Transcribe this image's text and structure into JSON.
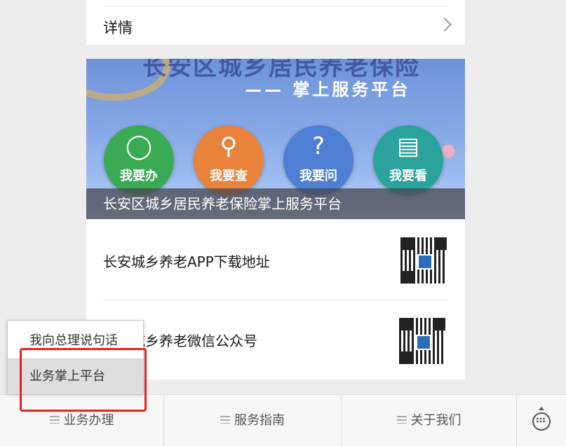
{
  "top_card": {
    "label": "详情"
  },
  "banner": {
    "headline": "长安区城乡居民养老保险",
    "subtitle": "—— 掌上服务平台",
    "buttons": [
      {
        "label": "我要办",
        "icon": "person-icon",
        "color": "#3aaa55"
      },
      {
        "label": "我要查",
        "icon": "search-icon",
        "color": "#e9823a"
      },
      {
        "label": "我要问",
        "icon": "question-icon",
        "color": "#4f7fd2"
      },
      {
        "label": "我要看",
        "icon": "document-icon",
        "color": "#2aa39c"
      }
    ],
    "caption": "长安区城乡居民养老保险掌上服务平台"
  },
  "qr_list": [
    {
      "label": "长安城乡养老APP下载地址"
    },
    {
      "label": "长安城乡养老微信公众号"
    }
  ],
  "popup": {
    "items": [
      "我向总理说句话",
      "业务掌上平台"
    ]
  },
  "tabbar": {
    "tabs": [
      "业务办理",
      "服务指南",
      "关于我们"
    ]
  },
  "colors": {
    "highlight": "#e8221b"
  }
}
